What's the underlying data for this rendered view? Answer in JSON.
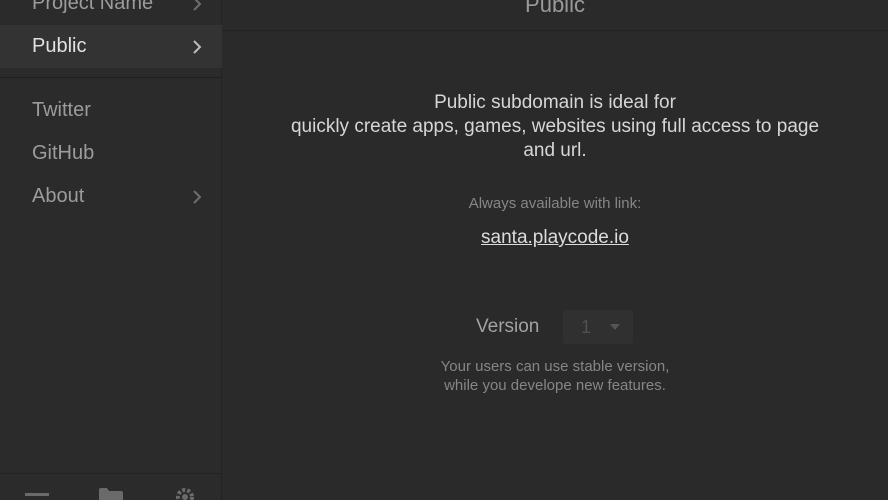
{
  "sidebar": {
    "items": [
      {
        "label": "Project Name",
        "has_chevron": true
      },
      {
        "label": "Public",
        "has_chevron": true,
        "active": true
      },
      {
        "label": "Twitter",
        "has_chevron": false
      },
      {
        "label": "GitHub",
        "has_chevron": false
      },
      {
        "label": "About",
        "has_chevron": true
      }
    ],
    "footer_icons": [
      "menu-icon",
      "folder-icon",
      "gear-icon"
    ]
  },
  "main": {
    "title": "Public",
    "description_lines": [
      "Public subdomain is ideal for",
      "quickly create apps, games, websites using full access to page",
      "and url."
    ],
    "available_label": "Always available with link:",
    "link_text": "santa.playcode.io",
    "version": {
      "label": "Version",
      "selected": "1"
    },
    "hint_lines": [
      "Your users can use stable version,",
      "while you develope new features."
    ]
  },
  "colors": {
    "background": "#2a2a2a",
    "sidebar_active": "#333333",
    "text_primary": "#d6d6d6",
    "text_muted": "#868686"
  }
}
